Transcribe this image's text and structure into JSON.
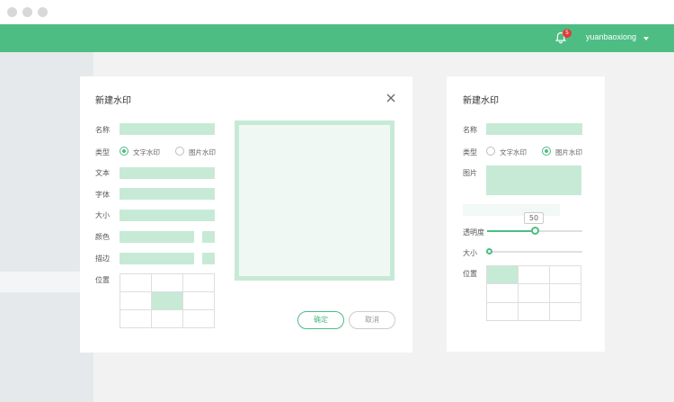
{
  "window": {
    "user": "yuanbaoxiong",
    "notification_count": "5"
  },
  "dialog": {
    "title": "新建水印",
    "labels": {
      "name": "名称",
      "type": "类型",
      "text": "文本",
      "font": "字体",
      "size": "大小",
      "color": "颜色",
      "stroke": "描边",
      "position": "位置"
    },
    "type_options": [
      {
        "label": "文字水印",
        "selected": true
      },
      {
        "label": "图片水印",
        "selected": false
      }
    ],
    "position_selected": "center",
    "confirm_label": "确定",
    "cancel_label": "取消"
  },
  "side_panel": {
    "title": "新建水印",
    "labels": {
      "name": "名称",
      "type": "类型",
      "image": "图片",
      "opacity": "透明度",
      "size": "大小",
      "position": "位置"
    },
    "type_options": [
      {
        "label": "文字水印",
        "selected": false
      },
      {
        "label": "图片水印",
        "selected": true
      }
    ],
    "opacity_value": "50",
    "opacity_fraction": 0.5,
    "size_fraction": 0,
    "position_selected": "top-left"
  },
  "colors": {
    "accent": "#4dbd84",
    "field_fill": "#c6ead6",
    "badge": "#e23b3b"
  }
}
